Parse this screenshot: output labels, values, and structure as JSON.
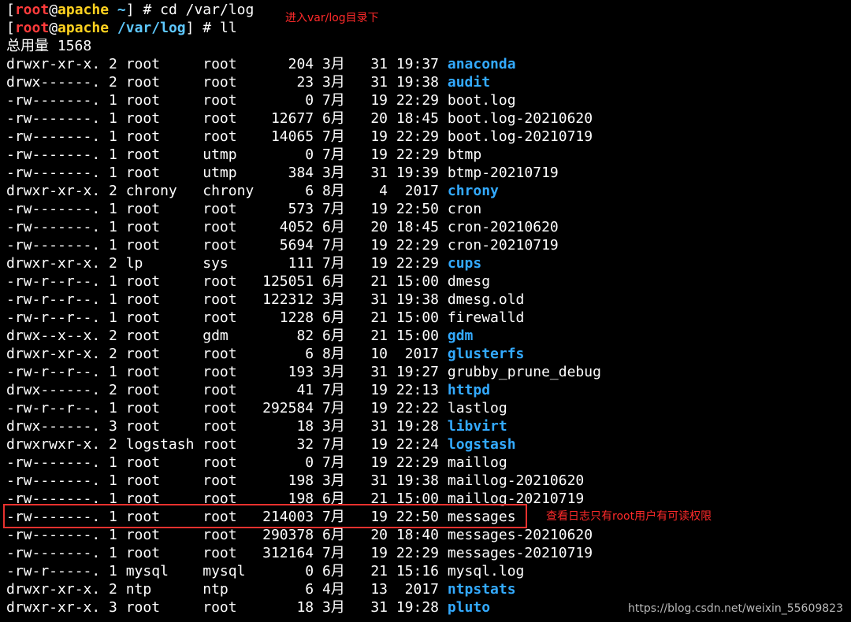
{
  "prompt": {
    "user": "root",
    "host": "apache",
    "open_bracket": "[",
    "close_bracket": "]",
    "at": "@",
    "symbol": " # "
  },
  "lines": [
    {
      "type": "prompt",
      "cwd": "~",
      "command": "cd /var/log"
    },
    {
      "type": "prompt",
      "cwd": "/var/log",
      "command": "ll"
    },
    {
      "type": "text",
      "text": "总用量 1568"
    },
    {
      "type": "entry",
      "prefix": "drwxr-xr-x. 2 root     root      204 3月   31 19:37 ",
      "name": "anaconda",
      "dir": true
    },
    {
      "type": "entry",
      "prefix": "drwx------. 2 root     root       23 3月   31 19:38 ",
      "name": "audit",
      "dir": true
    },
    {
      "type": "entry",
      "prefix": "-rw-------. 1 root     root        0 7月   19 22:29 ",
      "name": "boot.log",
      "dir": false
    },
    {
      "type": "entry",
      "prefix": "-rw-------. 1 root     root    12677 6月   20 18:45 ",
      "name": "boot.log-20210620",
      "dir": false
    },
    {
      "type": "entry",
      "prefix": "-rw-------. 1 root     root    14065 7月   19 22:29 ",
      "name": "boot.log-20210719",
      "dir": false
    },
    {
      "type": "entry",
      "prefix": "-rw-------. 1 root     utmp        0 7月   19 22:29 ",
      "name": "btmp",
      "dir": false
    },
    {
      "type": "entry",
      "prefix": "-rw-------. 1 root     utmp      384 3月   31 19:39 ",
      "name": "btmp-20210719",
      "dir": false
    },
    {
      "type": "entry",
      "prefix": "drwxr-xr-x. 2 chrony   chrony      6 8月    4  2017 ",
      "name": "chrony",
      "dir": true
    },
    {
      "type": "entry",
      "prefix": "-rw-------. 1 root     root      573 7月   19 22:50 ",
      "name": "cron",
      "dir": false
    },
    {
      "type": "entry",
      "prefix": "-rw-------. 1 root     root     4052 6月   20 18:45 ",
      "name": "cron-20210620",
      "dir": false
    },
    {
      "type": "entry",
      "prefix": "-rw-------. 1 root     root     5694 7月   19 22:29 ",
      "name": "cron-20210719",
      "dir": false
    },
    {
      "type": "entry",
      "prefix": "drwxr-xr-x. 2 lp       sys       111 7月   19 22:29 ",
      "name": "cups",
      "dir": true
    },
    {
      "type": "entry",
      "prefix": "-rw-r--r--. 1 root     root   125051 6月   21 15:00 ",
      "name": "dmesg",
      "dir": false
    },
    {
      "type": "entry",
      "prefix": "-rw-r--r--. 1 root     root   122312 3月   31 19:38 ",
      "name": "dmesg.old",
      "dir": false
    },
    {
      "type": "entry",
      "prefix": "-rw-r--r--. 1 root     root     1228 6月   21 15:00 ",
      "name": "firewalld",
      "dir": false
    },
    {
      "type": "entry",
      "prefix": "drwx--x--x. 2 root     gdm        82 6月   21 15:00 ",
      "name": "gdm",
      "dir": true
    },
    {
      "type": "entry",
      "prefix": "drwxr-xr-x. 2 root     root        6 8月   10  2017 ",
      "name": "glusterfs",
      "dir": true
    },
    {
      "type": "entry",
      "prefix": "-rw-r--r--. 1 root     root      193 3月   31 19:27 ",
      "name": "grubby_prune_debug",
      "dir": false
    },
    {
      "type": "entry",
      "prefix": "drwx------. 2 root     root       41 7月   19 22:13 ",
      "name": "httpd",
      "dir": true
    },
    {
      "type": "entry",
      "prefix": "-rw-r--r--. 1 root     root   292584 7月   19 22:22 ",
      "name": "lastlog",
      "dir": false
    },
    {
      "type": "entry",
      "prefix": "drwx------. 3 root     root       18 3月   31 19:28 ",
      "name": "libvirt",
      "dir": true
    },
    {
      "type": "entry",
      "prefix": "drwxrwxr-x. 2 logstash root       32 7月   19 22:24 ",
      "name": "logstash",
      "dir": true
    },
    {
      "type": "entry",
      "prefix": "-rw-------. 1 root     root        0 7月   19 22:29 ",
      "name": "maillog",
      "dir": false
    },
    {
      "type": "entry",
      "prefix": "-rw-------. 1 root     root      198 3月   31 19:38 ",
      "name": "maillog-20210620",
      "dir": false
    },
    {
      "type": "entry",
      "prefix": "-rw-------. 1 root     root      198 6月   21 15:00 ",
      "name": "maillog-20210719",
      "dir": false
    },
    {
      "type": "entry",
      "prefix": "-rw-------. 1 root     root   214003 7月   19 22:50 ",
      "name": "messages",
      "dir": false
    },
    {
      "type": "entry",
      "prefix": "-rw-------. 1 root     root   290378 6月   20 18:40 ",
      "name": "messages-20210620",
      "dir": false
    },
    {
      "type": "entry",
      "prefix": "-rw-------. 1 root     root   312164 7月   19 22:29 ",
      "name": "messages-20210719",
      "dir": false
    },
    {
      "type": "entry",
      "prefix": "-rw-r-----. 1 mysql    mysql       0 6月   21 15:16 ",
      "name": "mysql.log",
      "dir": false
    },
    {
      "type": "entry",
      "prefix": "drwxr-xr-x. 2 ntp      ntp         6 4月   13  2017 ",
      "name": "ntpstats",
      "dir": true
    },
    {
      "type": "entry",
      "prefix": "drwxr-xr-x. 3 root     root       18 3月   31 19:28 ",
      "name": "pluto",
      "dir": true
    }
  ],
  "annotations": {
    "cd_note": "进入var/log目录下",
    "messages_note": "查看日志只有root用户有可读权限"
  },
  "colors": {
    "background": "#000000",
    "text": "#ffffff",
    "prompt_user": "#ff3b3b",
    "prompt_host": "#ffd21f",
    "prompt_cwd": "#5ec8ff",
    "directory": "#33aaff",
    "annotation": "#ff2a2a",
    "highlight_box": "#e8312e",
    "watermark": "#b8b8b8"
  },
  "watermark": "https://blog.csdn.net/weixin_55609823"
}
